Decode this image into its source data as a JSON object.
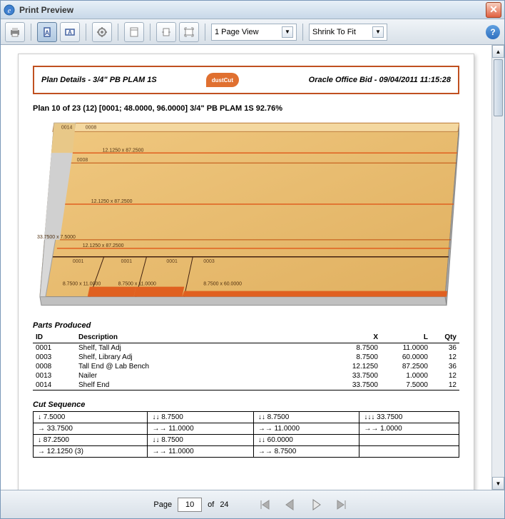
{
  "window": {
    "title": "Print Preview"
  },
  "toolbar": {
    "pageViewLabel": "1 Page View",
    "shrinkLabel": "Shrink To Fit"
  },
  "header": {
    "left": "Plan Details - 3/4\" PB PLAM 1S",
    "logoText": "dustCut",
    "right": "Oracle Office Bid - 09/04/2011 11:15:28"
  },
  "planInfo": "Plan 10 of 23 (12) [0001; 48.0000, 96.0000] 3/4\" PB PLAM 1S 92.76%",
  "diagram": {
    "labels": [
      {
        "id": "0014"
      },
      {
        "id": "0008"
      },
      {
        "dim": "12.1250 x 87.2500"
      },
      {
        "id": "0008"
      },
      {
        "dim": "12.1250 x 87.2500"
      },
      {
        "dim": "33.7500 x 7.5000"
      },
      {
        "dim": "12.1250 x 87.2500"
      },
      {
        "id": "0001"
      },
      {
        "id": "0001"
      },
      {
        "id": "0001"
      },
      {
        "id": "0003"
      },
      {
        "dim": "8.7500 x 11.0000"
      },
      {
        "dim": "8.7500 x 11.0000"
      },
      {
        "dim": "8.7500 x 60.0000"
      }
    ]
  },
  "partsProduced": {
    "title": "Parts Produced",
    "cols": [
      "ID",
      "Description",
      "X",
      "L",
      "Qty"
    ],
    "rows": [
      {
        "id": "0001",
        "desc": "Shelf, Tall Adj",
        "x": "8.7500",
        "l": "11.0000",
        "qty": "36"
      },
      {
        "id": "0003",
        "desc": "Shelf, Library Adj",
        "x": "8.7500",
        "l": "60.0000",
        "qty": "12"
      },
      {
        "id": "0008",
        "desc": "Tall End @ Lab Bench",
        "x": "12.1250",
        "l": "87.2500",
        "qty": "36"
      },
      {
        "id": "0013",
        "desc": "Nailer",
        "x": "33.7500",
        "l": "1.0000",
        "qty": "12"
      },
      {
        "id": "0014",
        "desc": "Shelf End",
        "x": "33.7500",
        "l": "7.5000",
        "qty": "12"
      }
    ]
  },
  "cutSequence": {
    "title": "Cut Sequence",
    "rows": [
      [
        {
          "arrow": "↓",
          "val": "7.5000"
        },
        {
          "arrow": "↓↓",
          "val": "8.7500"
        },
        {
          "arrow": "↓↓",
          "val": "8.7500"
        },
        {
          "arrow": "↓↓↓",
          "val": "33.7500"
        }
      ],
      [
        {
          "arrow": "→",
          "val": "33.7500"
        },
        {
          "arrow": "→→",
          "val": "11.0000"
        },
        {
          "arrow": "→→",
          "val": "11.0000"
        },
        {
          "arrow": "→→",
          "val": "1.0000"
        }
      ],
      [
        {
          "arrow": "↓",
          "val": "87.2500"
        },
        {
          "arrow": "↓↓",
          "val": "8.7500"
        },
        {
          "arrow": "↓↓",
          "val": "60.0000"
        },
        {
          "arrow": "",
          "val": ""
        }
      ],
      [
        {
          "arrow": "→",
          "val": "12.1250 (3)"
        },
        {
          "arrow": "→→",
          "val": "11.0000"
        },
        {
          "arrow": "→→",
          "val": "8.7500"
        },
        {
          "arrow": "",
          "val": ""
        }
      ]
    ]
  },
  "footer": {
    "pageLabel": "Page",
    "currentPage": "10",
    "ofLabel": "of",
    "totalPages": "24"
  }
}
